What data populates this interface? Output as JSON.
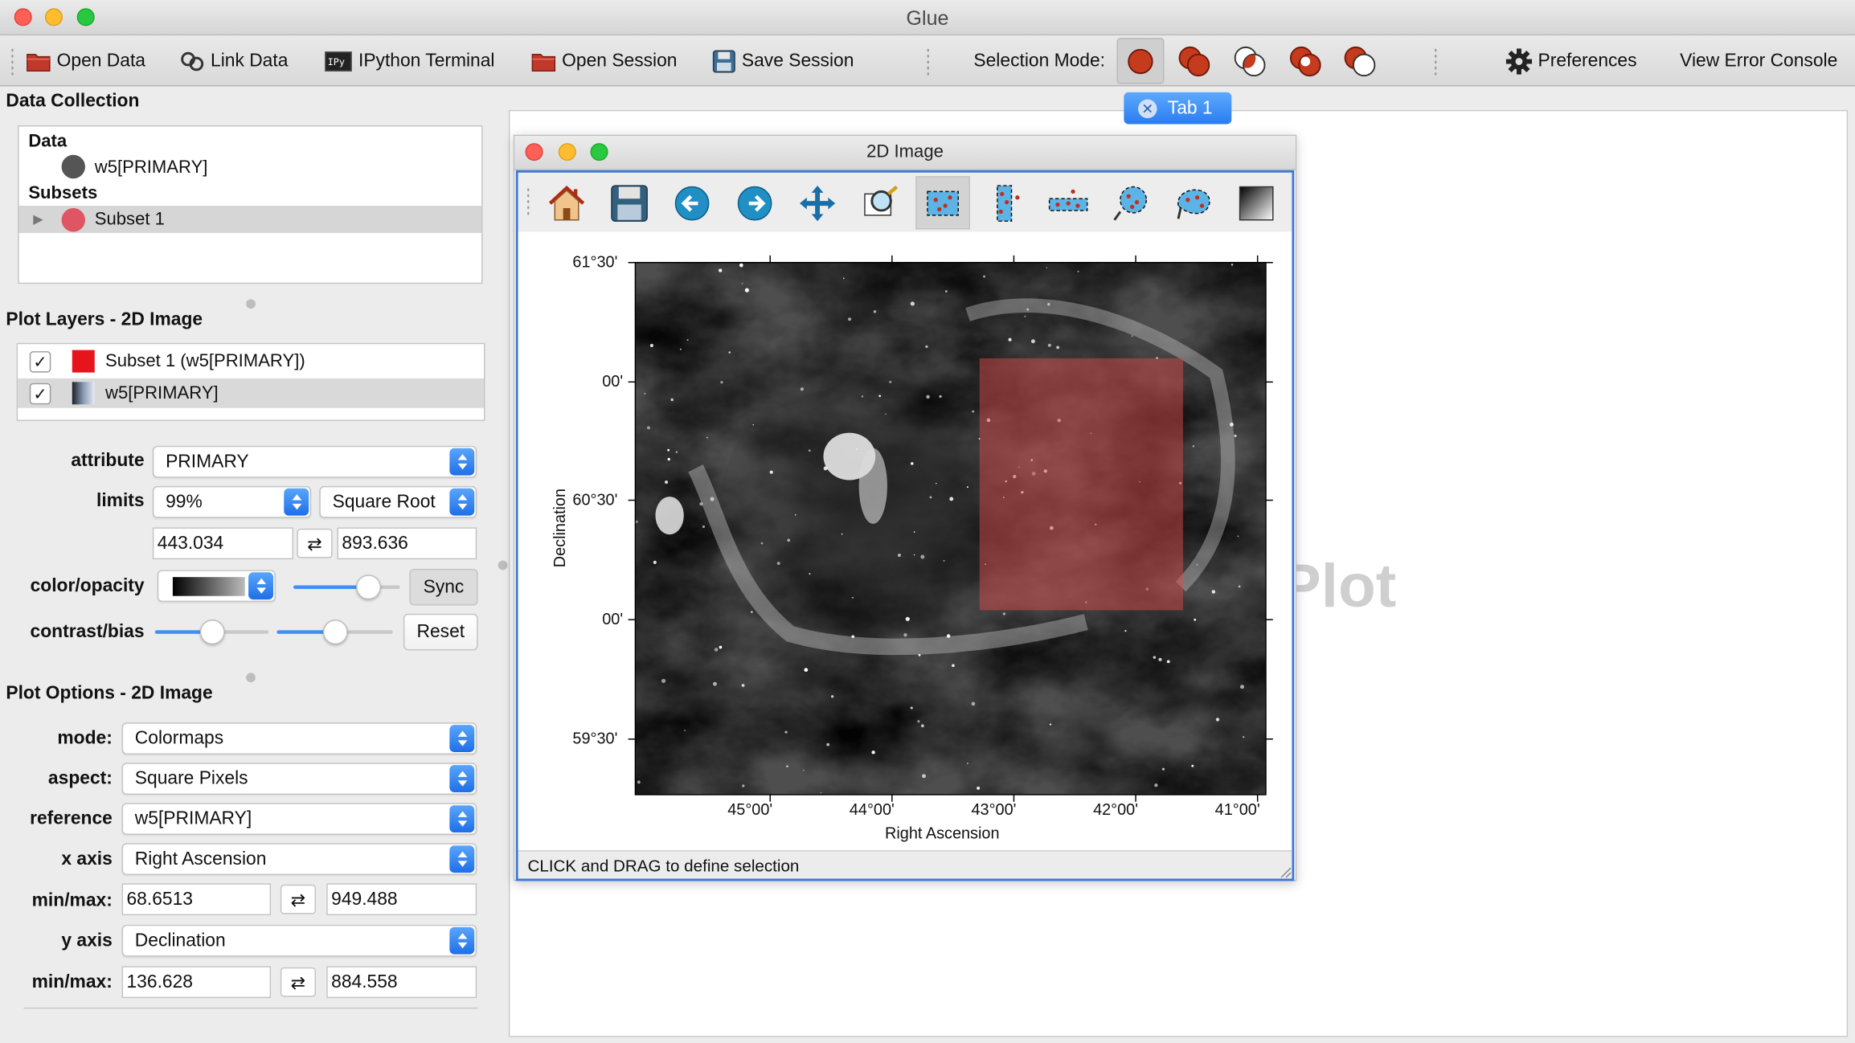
{
  "window": {
    "title": "Glue"
  },
  "toolbar": {
    "open_data": "Open Data",
    "link_data": "Link Data",
    "ipython_terminal": "IPython Terminal",
    "open_session": "Open Session",
    "save_session": "Save Session",
    "selection_mode": "Selection Mode:",
    "preferences": "Preferences",
    "view_error_console": "View Error Console",
    "selection_modes": [
      "replace",
      "union",
      "intersection",
      "xor",
      "remove"
    ]
  },
  "data_collection": {
    "title": "Data Collection",
    "data_header": "Data",
    "data_items": [
      {
        "label": "w5[PRIMARY]",
        "color": "#555555"
      }
    ],
    "subsets_header": "Subsets",
    "subset_items": [
      {
        "label": "Subset 1",
        "color": "#e05563"
      }
    ]
  },
  "plot_layers": {
    "title": "Plot Layers - 2D Image",
    "layers": [
      {
        "label": "Subset 1 (w5[PRIMARY])",
        "checked": "✓",
        "color": "#e8141c"
      },
      {
        "label": "w5[PRIMARY]",
        "checked": "✓",
        "color": "gradient"
      }
    ],
    "attribute_label": "attribute",
    "attribute_value": "PRIMARY",
    "limits_label": "limits",
    "limits_percentile": "99%",
    "stretch": "Square Root",
    "vmin": "443.034",
    "vmax": "893.636",
    "swap_glyph": "⇄",
    "color_label": "color/opacity",
    "opacity": 0.77,
    "sync_label": "Sync",
    "contrast_label": "contrast/bias",
    "contrast": 0.5,
    "bias": 0.5,
    "reset_label": "Reset"
  },
  "plot_options": {
    "title": "Plot Options - 2D Image",
    "mode_label": "mode:",
    "mode_value": "Colormaps",
    "aspect_label": "aspect:",
    "aspect_value": "Square Pixels",
    "reference_label": "reference",
    "reference_value": "w5[PRIMARY]",
    "xaxis_label": "x axis",
    "xaxis_value": "Right Ascension",
    "xminmax_label": "min/max:",
    "x_min": "68.6513",
    "x_max": "949.488",
    "yaxis_label": "y axis",
    "yaxis_value": "Declination",
    "yminmax_label": "min/max:",
    "y_min": "136.628",
    "y_max": "884.558"
  },
  "tabs": [
    {
      "label": "Tab 1"
    }
  ],
  "background_hint": "Plot",
  "image_window": {
    "title": "2D Image",
    "status": "CLICK and DRAG to define selection",
    "xlabel": "Right Ascension",
    "ylabel": "Declination",
    "xticks": [
      "45°00'",
      "44°00'",
      "43°00'",
      "42°00'",
      "41°00'"
    ],
    "yticks": [
      "61°30'",
      "00'",
      "60°30'",
      "00'",
      "59°30'"
    ],
    "subset_color": "#d84a4a"
  }
}
